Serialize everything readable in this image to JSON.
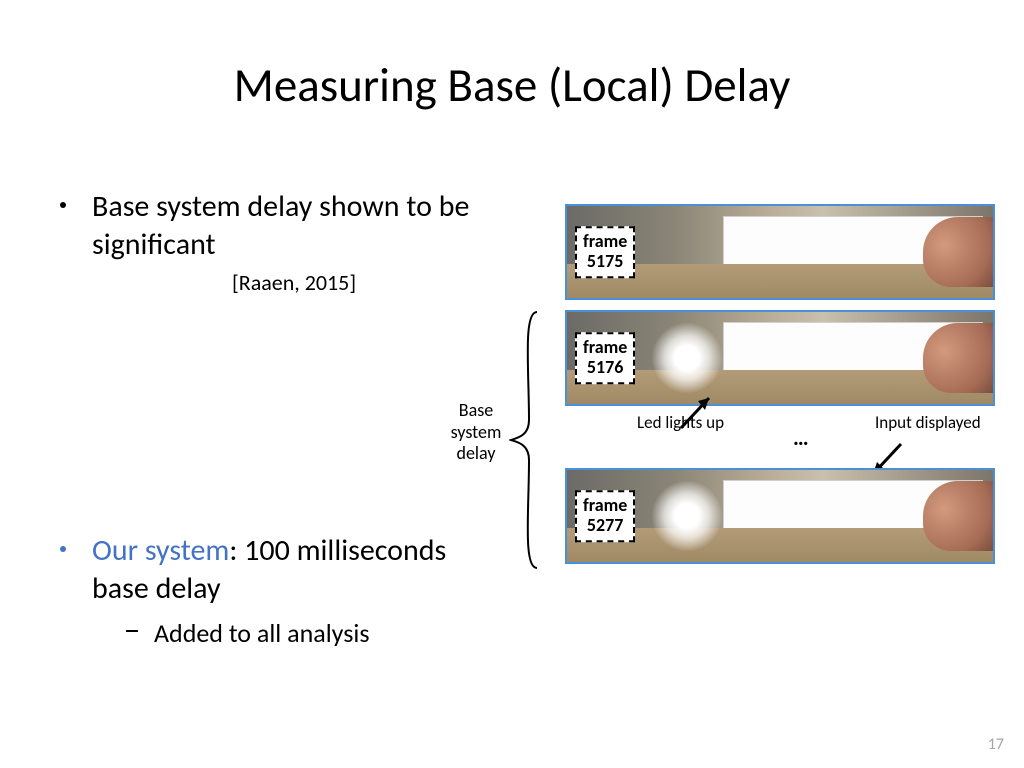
{
  "title": "Measuring Base (Local) Delay",
  "bullets": {
    "b1": "Base system  delay shown to be significant",
    "citation": "[Raaen, 2015]",
    "b2_highlight": "Our system",
    "b2_rest": ": 100 milliseconds base delay",
    "sub": "Added to all analysis"
  },
  "figure": {
    "frame1_label_top": "frame",
    "frame1_label_num": "5175",
    "frame2_label_top": "frame",
    "frame2_label_num": "5176",
    "frame3_label_top": "frame",
    "frame3_label_num": "5277",
    "anno_led": "Led lights up",
    "anno_dots": "…",
    "anno_input": "Input displayed",
    "brace_label": "Base system delay"
  },
  "page_number": "17"
}
